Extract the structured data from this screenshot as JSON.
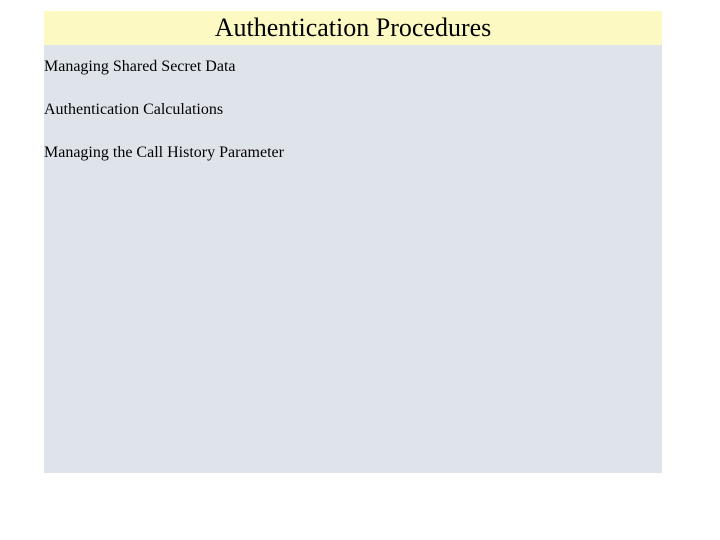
{
  "title": "Authentication Procedures",
  "items": [
    "Managing Shared Secret Data",
    "Authentication Calculations",
    "Managing the Call History Parameter"
  ]
}
